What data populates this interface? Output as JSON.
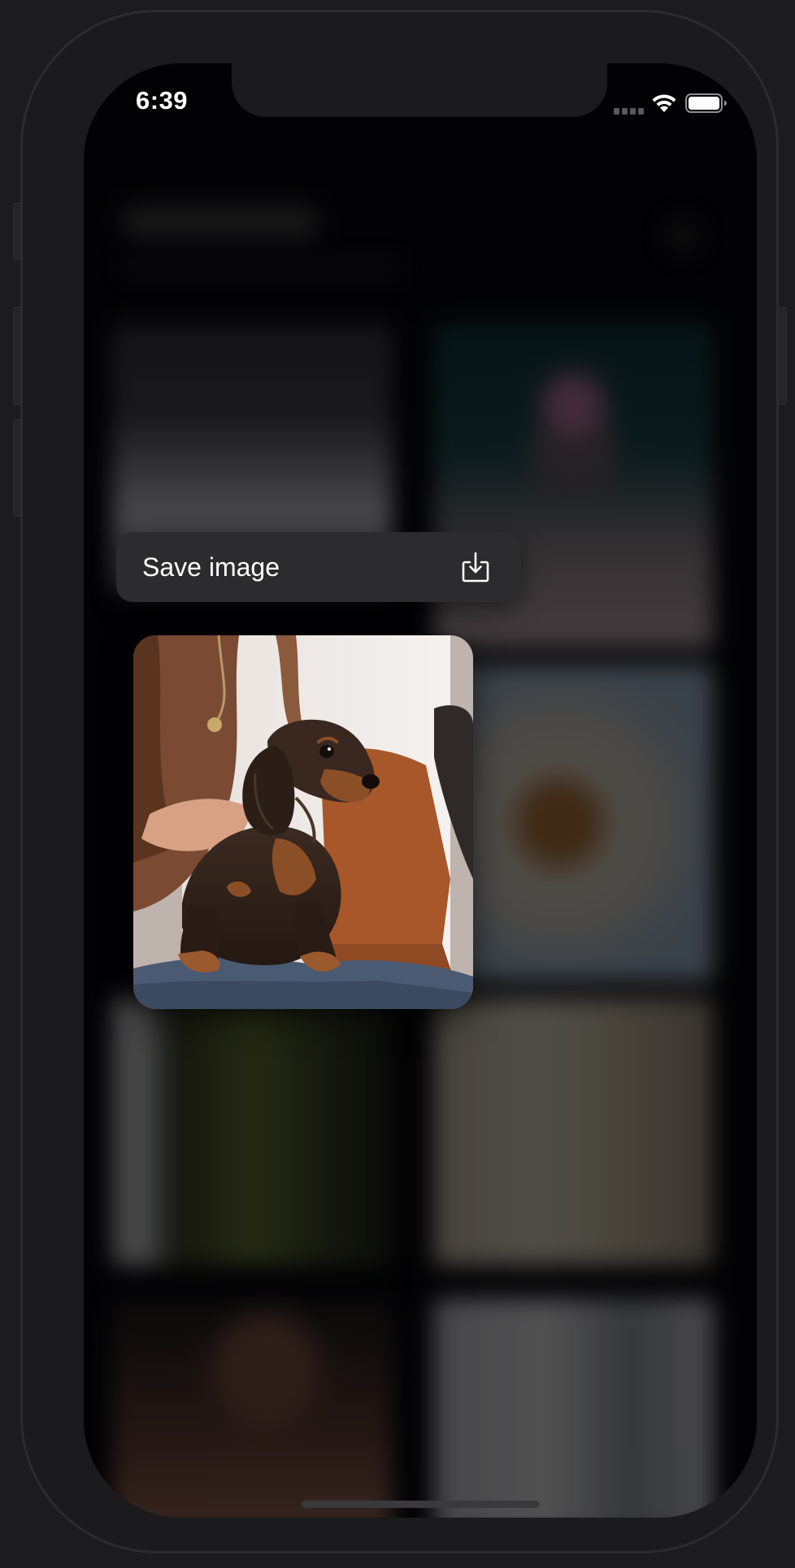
{
  "status_bar": {
    "time": "6:39"
  },
  "context_menu": {
    "save_label": "Save image",
    "save_icon": "square-and-arrow-down-icon"
  },
  "preview": {
    "subject": "dachshund-puppy-photo"
  },
  "colors": {
    "screen_background": "#040407",
    "menu_background": "#2c2c2e",
    "menu_text": "#ffffff",
    "device_frame": "#1b1b1d"
  }
}
